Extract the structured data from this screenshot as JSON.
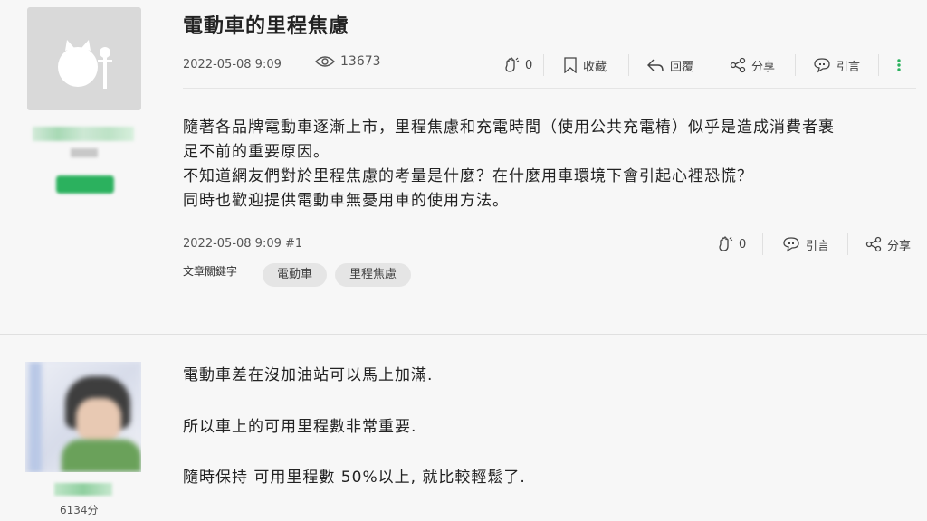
{
  "post1": {
    "title": "電動車的里程焦慮",
    "date": "2022-05-08 9:09",
    "views": "13673",
    "actions": {
      "like_count": "0",
      "bookmark": "收藏",
      "reply": "回覆",
      "share": "分享",
      "quote": "引言"
    },
    "body": [
      "隨著各品牌電動車逐漸上市，里程焦慮和充電時間（使用公共充電樁）似乎是造成消費者裹",
      "足不前的重要原因。",
      "不知道網友們對於里程焦慮的考量是什麼？在什麼用車環境下會引起心裡恐慌？",
      "同時也歡迎提供電動車無憂用車的使用方法。"
    ],
    "footer": {
      "date_floor": "2022-05-08 9:09 #1",
      "like_count": "0",
      "quote": "引言",
      "share": "分享"
    },
    "keywords_label": "文章關鍵字",
    "keywords": [
      "電動車",
      "里程焦慮"
    ]
  },
  "post2": {
    "body": [
      "電動車差在沒加油站可以馬上加滿.",
      "所以車上的可用里程數非常重要.",
      "隨時保持 可用里程數 50%以上, 就比較輕鬆了."
    ],
    "score": "6134分"
  },
  "icons": {
    "eye": "eye-icon",
    "clap": "clap-icon",
    "bookmark": "bookmark-icon",
    "reply": "reply-icon",
    "share": "share-icon",
    "quote": "quote-icon",
    "more": "more-vertical-icon"
  },
  "colors": {
    "accent_green": "#2bb15e",
    "more_icon": "#2bb15e"
  }
}
